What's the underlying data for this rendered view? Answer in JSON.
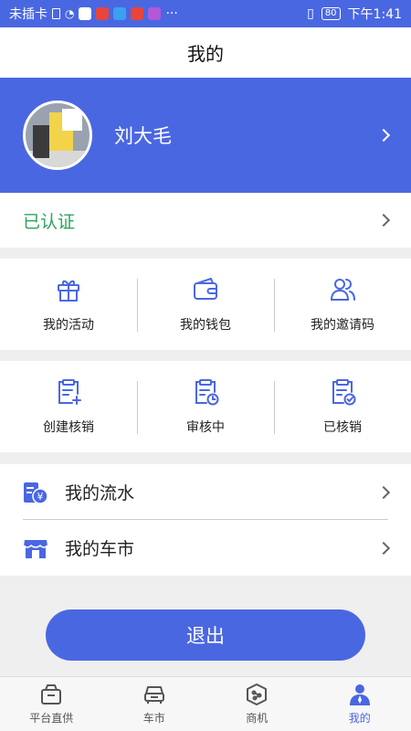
{
  "statusbar": {
    "carrier": "未插卡",
    "battery": "80",
    "time": "下午1:41",
    "more": "···"
  },
  "title": "我的",
  "profile": {
    "name": "刘大毛"
  },
  "verified": {
    "label": "已认证"
  },
  "grid1": [
    {
      "label": "我的活动",
      "icon": "gift-icon"
    },
    {
      "label": "我的钱包",
      "icon": "wallet-icon"
    },
    {
      "label": "我的邀请码",
      "icon": "users-icon"
    }
  ],
  "grid2": [
    {
      "label": "创建核销",
      "icon": "clipboard-add-icon"
    },
    {
      "label": "审核中",
      "icon": "clipboard-clock-icon"
    },
    {
      "label": "已核销",
      "icon": "clipboard-check-icon"
    }
  ],
  "list": [
    {
      "label": "我的流水",
      "icon": "ledger-yen-icon"
    },
    {
      "label": "我的车市",
      "icon": "store-icon"
    }
  ],
  "logout": "退出",
  "tabs": [
    {
      "label": "平台直供",
      "icon": "box-icon"
    },
    {
      "label": "车市",
      "icon": "car-icon"
    },
    {
      "label": "商机",
      "icon": "cube-share-icon"
    },
    {
      "label": "我的",
      "icon": "person-icon"
    }
  ],
  "colors": {
    "primary": "#4a67e2",
    "verified": "#2aa45e"
  }
}
